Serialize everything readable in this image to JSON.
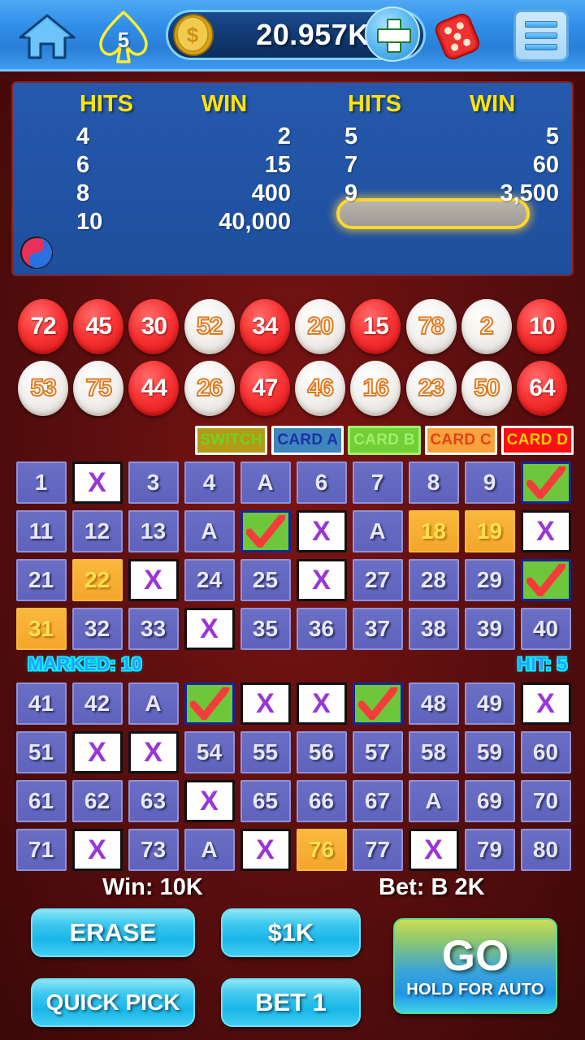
{
  "topbar": {
    "home_icon": "home-icon",
    "spade_icon": "spade-icon",
    "spade_count": "5",
    "coin_icon": "coin-icon",
    "coin_amount": "20.957K",
    "plus_icon": "plus-icon",
    "dice_icon": "dice-icon",
    "menu_icon": "menu-icon"
  },
  "paytable": {
    "left": {
      "hits_header": "HITS",
      "win_header": "WIN",
      "rows": [
        {
          "hits": "4",
          "win": "2"
        },
        {
          "hits": "6",
          "win": "15"
        },
        {
          "hits": "8",
          "win": "400"
        },
        {
          "hits": "10",
          "win": "40,000"
        }
      ]
    },
    "right": {
      "hits_header": "HITS",
      "win_header": "WIN",
      "rows": [
        {
          "hits": "5",
          "win": "5",
          "highlighted": true
        },
        {
          "hits": "7",
          "win": "60"
        },
        {
          "hits": "9",
          "win": "3,500"
        }
      ]
    },
    "badge_icon": "yinyang-icon"
  },
  "drawn_balls": {
    "row1": [
      {
        "value": "72",
        "style": "red"
      },
      {
        "value": "45",
        "style": "red"
      },
      {
        "value": "30",
        "style": "red"
      },
      {
        "value": "52",
        "style": "white"
      },
      {
        "value": "34",
        "style": "red"
      },
      {
        "value": "20",
        "style": "white"
      },
      {
        "value": "15",
        "style": "red"
      },
      {
        "value": "78",
        "style": "white"
      },
      {
        "value": "2",
        "style": "white"
      },
      {
        "value": "10",
        "style": "red"
      }
    ],
    "row2": [
      {
        "value": "53",
        "style": "white"
      },
      {
        "value": "75",
        "style": "white"
      },
      {
        "value": "44",
        "style": "red"
      },
      {
        "value": "26",
        "style": "white"
      },
      {
        "value": "47",
        "style": "red"
      },
      {
        "value": "46",
        "style": "white"
      },
      {
        "value": "16",
        "style": "white"
      },
      {
        "value": "23",
        "style": "white"
      },
      {
        "value": "50",
        "style": "white"
      },
      {
        "value": "64",
        "style": "red"
      }
    ]
  },
  "card_tabs": [
    {
      "label": "SWITCH",
      "key": "switch"
    },
    {
      "label": "CARD A",
      "key": "a"
    },
    {
      "label": "CARD B",
      "key": "b",
      "selected": true
    },
    {
      "label": "CARD C",
      "key": "c"
    },
    {
      "label": "CARD D",
      "key": "d"
    }
  ],
  "keno_board": {
    "grid_top": [
      {
        "label": "1",
        "state": "plain"
      },
      {
        "label": "X",
        "state": "xmark"
      },
      {
        "label": "3",
        "state": "plain"
      },
      {
        "label": "4",
        "state": "plain"
      },
      {
        "label": "A",
        "state": "plain"
      },
      {
        "label": "6",
        "state": "plain"
      },
      {
        "label": "7",
        "state": "plain"
      },
      {
        "label": "8",
        "state": "plain"
      },
      {
        "label": "9",
        "state": "plain"
      },
      {
        "label": "",
        "state": "check"
      },
      {
        "label": "11",
        "state": "plain"
      },
      {
        "label": "12",
        "state": "plain"
      },
      {
        "label": "13",
        "state": "plain"
      },
      {
        "label": "A",
        "state": "plain"
      },
      {
        "label": "",
        "state": "check"
      },
      {
        "label": "X",
        "state": "xmark"
      },
      {
        "label": "A",
        "state": "plain"
      },
      {
        "label": "18",
        "state": "orange"
      },
      {
        "label": "19",
        "state": "orange"
      },
      {
        "label": "X",
        "state": "xmark"
      },
      {
        "label": "21",
        "state": "plain"
      },
      {
        "label": "22",
        "state": "orange"
      },
      {
        "label": "X",
        "state": "xmark"
      },
      {
        "label": "24",
        "state": "plain"
      },
      {
        "label": "25",
        "state": "plain"
      },
      {
        "label": "X",
        "state": "xmark"
      },
      {
        "label": "27",
        "state": "plain"
      },
      {
        "label": "28",
        "state": "plain"
      },
      {
        "label": "29",
        "state": "plain"
      },
      {
        "label": "",
        "state": "check"
      },
      {
        "label": "31",
        "state": "orange"
      },
      {
        "label": "32",
        "state": "plain"
      },
      {
        "label": "33",
        "state": "plain"
      },
      {
        "label": "X",
        "state": "xmark"
      },
      {
        "label": "35",
        "state": "plain"
      },
      {
        "label": "36",
        "state": "plain"
      },
      {
        "label": "37",
        "state": "plain"
      },
      {
        "label": "38",
        "state": "plain"
      },
      {
        "label": "39",
        "state": "plain"
      },
      {
        "label": "40",
        "state": "plain"
      }
    ],
    "grid_bottom": [
      {
        "label": "41",
        "state": "plain"
      },
      {
        "label": "42",
        "state": "plain"
      },
      {
        "label": "A",
        "state": "plain"
      },
      {
        "label": "",
        "state": "check"
      },
      {
        "label": "X",
        "state": "xmark"
      },
      {
        "label": "X",
        "state": "xmark"
      },
      {
        "label": "",
        "state": "check"
      },
      {
        "label": "48",
        "state": "plain"
      },
      {
        "label": "49",
        "state": "plain"
      },
      {
        "label": "X",
        "state": "xmark"
      },
      {
        "label": "51",
        "state": "plain"
      },
      {
        "label": "X",
        "state": "xmark"
      },
      {
        "label": "X",
        "state": "xmark"
      },
      {
        "label": "54",
        "state": "plain"
      },
      {
        "label": "55",
        "state": "plain"
      },
      {
        "label": "56",
        "state": "plain"
      },
      {
        "label": "57",
        "state": "plain"
      },
      {
        "label": "58",
        "state": "plain"
      },
      {
        "label": "59",
        "state": "plain"
      },
      {
        "label": "60",
        "state": "plain"
      },
      {
        "label": "61",
        "state": "plain"
      },
      {
        "label": "62",
        "state": "plain"
      },
      {
        "label": "63",
        "state": "plain"
      },
      {
        "label": "X",
        "state": "xmark"
      },
      {
        "label": "65",
        "state": "plain"
      },
      {
        "label": "66",
        "state": "plain"
      },
      {
        "label": "67",
        "state": "plain"
      },
      {
        "label": "A",
        "state": "plain"
      },
      {
        "label": "69",
        "state": "plain"
      },
      {
        "label": "70",
        "state": "plain"
      },
      {
        "label": "71",
        "state": "plain"
      },
      {
        "label": "X",
        "state": "xmark"
      },
      {
        "label": "73",
        "state": "plain"
      },
      {
        "label": "A",
        "state": "plain"
      },
      {
        "label": "X",
        "state": "xmark"
      },
      {
        "label": "76",
        "state": "orange"
      },
      {
        "label": "77",
        "state": "plain"
      },
      {
        "label": "X",
        "state": "xmark"
      },
      {
        "label": "79",
        "state": "plain"
      },
      {
        "label": "80",
        "state": "plain"
      }
    ]
  },
  "status": {
    "marked": "MARKED: 10",
    "hit": "HIT: 5"
  },
  "totals": {
    "win": "Win: 10K",
    "bet": "Bet: B 2K"
  },
  "buttons": {
    "erase": "ERASE",
    "quick_pick": "QUICK PICK",
    "amount": "$1K",
    "bet1": "BET 1",
    "go": "GO",
    "go_sub": "HOLD FOR AUTO"
  },
  "colors": {
    "accent_blue": "#2f8de8",
    "paytable_bg": "#2559ad",
    "highlight_yellow": "#ffd630",
    "cell_purple": "#6b6ec4",
    "cell_orange": "#f9b93c",
    "check_green": "#6ec63a",
    "x_purple": "#9b35d6",
    "ball_red": "#f93434",
    "table_red": "#5e0f0f"
  }
}
